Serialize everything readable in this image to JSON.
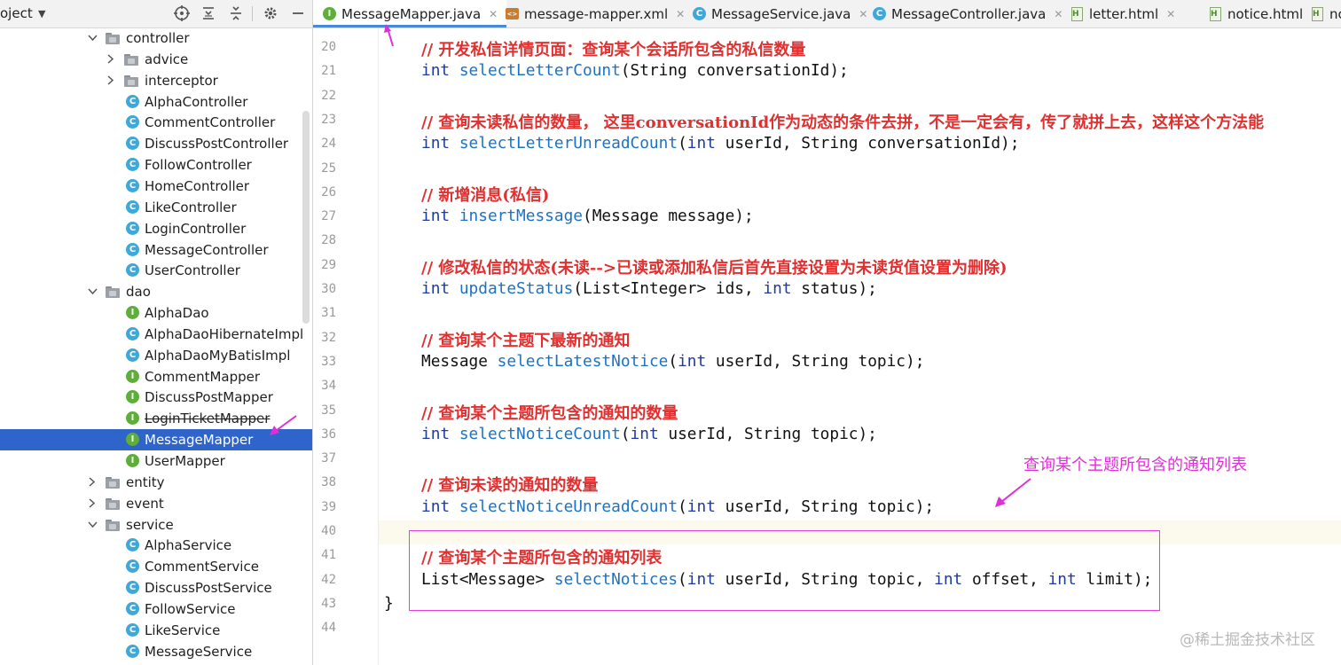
{
  "panel": {
    "title": "oject",
    "tree": [
      {
        "label": "controller",
        "kind": "folder",
        "depth": 1,
        "expanded": true
      },
      {
        "label": "advice",
        "kind": "folder",
        "depth": 2,
        "expanded": false
      },
      {
        "label": "interceptor",
        "kind": "folder",
        "depth": 2,
        "expanded": false
      },
      {
        "label": "AlphaController",
        "kind": "class",
        "depth": 2
      },
      {
        "label": "CommentController",
        "kind": "class",
        "depth": 2
      },
      {
        "label": "DiscussPostController",
        "kind": "class",
        "depth": 2
      },
      {
        "label": "FollowController",
        "kind": "class",
        "depth": 2
      },
      {
        "label": "HomeController",
        "kind": "class",
        "depth": 2
      },
      {
        "label": "LikeController",
        "kind": "class",
        "depth": 2
      },
      {
        "label": "LoginController",
        "kind": "class",
        "depth": 2
      },
      {
        "label": "MessageController",
        "kind": "class",
        "depth": 2
      },
      {
        "label": "UserController",
        "kind": "class",
        "depth": 2
      },
      {
        "label": "dao",
        "kind": "folder",
        "depth": 1,
        "expanded": true
      },
      {
        "label": "AlphaDao",
        "kind": "interface",
        "depth": 2
      },
      {
        "label": "AlphaDaoHibernateImpl",
        "kind": "class",
        "depth": 2
      },
      {
        "label": "AlphaDaoMyBatisImpl",
        "kind": "class",
        "depth": 2
      },
      {
        "label": "CommentMapper",
        "kind": "interface",
        "depth": 2
      },
      {
        "label": "DiscussPostMapper",
        "kind": "interface",
        "depth": 2
      },
      {
        "label": "LoginTicketMapper",
        "kind": "interface",
        "depth": 2,
        "strikethrough": true
      },
      {
        "label": "MessageMapper",
        "kind": "interface",
        "depth": 2,
        "selected": true
      },
      {
        "label": "UserMapper",
        "kind": "interface",
        "depth": 2
      },
      {
        "label": "entity",
        "kind": "folder",
        "depth": 1,
        "expanded": false
      },
      {
        "label": "event",
        "kind": "folder",
        "depth": 1,
        "expanded": false
      },
      {
        "label": "service",
        "kind": "folder",
        "depth": 1,
        "expanded": true
      },
      {
        "label": "AlphaService",
        "kind": "class",
        "depth": 2
      },
      {
        "label": "CommentService",
        "kind": "class",
        "depth": 2
      },
      {
        "label": "DiscussPostService",
        "kind": "class",
        "depth": 2
      },
      {
        "label": "FollowService",
        "kind": "class",
        "depth": 2
      },
      {
        "label": "LikeService",
        "kind": "class",
        "depth": 2
      },
      {
        "label": "MessageService",
        "kind": "class",
        "depth": 2
      }
    ]
  },
  "tabs": [
    {
      "label": "MessageMapper.java",
      "icon": "interface-icon",
      "active": true
    },
    {
      "label": "message-mapper.xml",
      "icon": "xml-file-icon"
    },
    {
      "label": "MessageService.java",
      "icon": "class-icon"
    },
    {
      "label": "MessageController.java",
      "icon": "class-icon"
    },
    {
      "label": "letter.html",
      "icon": "html-file-icon"
    },
    {
      "label": "notice.html",
      "icon": "html-file-icon"
    },
    {
      "label": "nc",
      "icon": "html-file-icon"
    }
  ],
  "editor": {
    "current_line": 40,
    "lines": [
      {
        "n": 20,
        "tokens": [
          [
            "cm",
            "// 开发私信详情页面：查询某个会话所包含的私信数量"
          ]
        ]
      },
      {
        "n": 21,
        "tokens": [
          [
            "kw",
            "int "
          ],
          [
            "fn",
            "selectLetterCount"
          ],
          [
            "pl",
            "(String conversationId);"
          ]
        ]
      },
      {
        "n": 22,
        "tokens": []
      },
      {
        "n": 23,
        "tokens": [
          [
            "cm",
            "// 查询未读私信的数量， 这里conversationId作为动态的条件去拼，不是一定会有，传了就拼上去，这样这个方法能"
          ]
        ]
      },
      {
        "n": 24,
        "tokens": [
          [
            "kw",
            "int "
          ],
          [
            "fn",
            "selectLetterUnreadCount"
          ],
          [
            "pl",
            "("
          ],
          [
            "kw",
            "int "
          ],
          [
            "pl",
            "userId, String conversationId);"
          ]
        ]
      },
      {
        "n": 25,
        "tokens": []
      },
      {
        "n": 26,
        "tokens": [
          [
            "cm",
            "// 新增消息(私信)"
          ]
        ]
      },
      {
        "n": 27,
        "tokens": [
          [
            "kw",
            "int "
          ],
          [
            "fn",
            "insertMessage"
          ],
          [
            "pl",
            "(Message message);"
          ]
        ]
      },
      {
        "n": 28,
        "tokens": []
      },
      {
        "n": 29,
        "tokens": [
          [
            "cm",
            "// 修改私信的状态(未读-->已读或添加私信后首先直接设置为未读货值设置为删除)"
          ]
        ]
      },
      {
        "n": 30,
        "tokens": [
          [
            "kw",
            "int "
          ],
          [
            "fn",
            "updateStatus"
          ],
          [
            "pl",
            "(List<Integer> ids, "
          ],
          [
            "kw",
            "int "
          ],
          [
            "pl",
            "status);"
          ]
        ]
      },
      {
        "n": 31,
        "tokens": []
      },
      {
        "n": 32,
        "tokens": [
          [
            "cm",
            "// 查询某个主题下最新的通知"
          ]
        ]
      },
      {
        "n": 33,
        "tokens": [
          [
            "pl",
            "Message "
          ],
          [
            "fn",
            "selectLatestNotice"
          ],
          [
            "pl",
            "("
          ],
          [
            "kw",
            "int "
          ],
          [
            "pl",
            "userId, String topic);"
          ]
        ]
      },
      {
        "n": 34,
        "tokens": []
      },
      {
        "n": 35,
        "tokens": [
          [
            "cm",
            "// 查询某个主题所包含的通知的数量"
          ]
        ]
      },
      {
        "n": 36,
        "tokens": [
          [
            "kw",
            "int "
          ],
          [
            "fn",
            "selectNoticeCount"
          ],
          [
            "pl",
            "("
          ],
          [
            "kw",
            "int "
          ],
          [
            "pl",
            "userId, String topic);"
          ]
        ]
      },
      {
        "n": 37,
        "tokens": []
      },
      {
        "n": 38,
        "tokens": [
          [
            "cm",
            "// 查询未读的通知的数量"
          ]
        ]
      },
      {
        "n": 39,
        "tokens": [
          [
            "kw",
            "int "
          ],
          [
            "fn",
            "selectNoticeUnreadCount"
          ],
          [
            "pl",
            "("
          ],
          [
            "kw",
            "int "
          ],
          [
            "pl",
            "userId, String topic);"
          ]
        ]
      },
      {
        "n": 40,
        "tokens": []
      },
      {
        "n": 41,
        "tokens": [
          [
            "cm",
            "// 查询某个主题所包含的通知列表"
          ]
        ]
      },
      {
        "n": 42,
        "tokens": [
          [
            "pl",
            "List<Message> "
          ],
          [
            "fn",
            "selectNotices"
          ],
          [
            "pl",
            "("
          ],
          [
            "kw",
            "int "
          ],
          [
            "pl",
            "userId, String topic, "
          ],
          [
            "kw",
            "int "
          ],
          [
            "pl",
            "offset, "
          ],
          [
            "kw",
            "int "
          ],
          [
            "pl",
            "limit);"
          ]
        ]
      },
      {
        "n": 43,
        "tokens": [
          [
            "pl",
            "}"
          ]
        ],
        "closing": true
      },
      {
        "n": 44,
        "tokens": []
      }
    ]
  },
  "annotation": {
    "text": "查询某个主题所包含的通知列表",
    "color": "#e02ed8"
  },
  "watermark": "@稀土掘金技术社区",
  "colors": {
    "selection": "#2f65ca",
    "comment": "#e03030",
    "keyword": "#1f3a9e",
    "method": "#1d72c4",
    "annotation": "#e83ce0"
  }
}
